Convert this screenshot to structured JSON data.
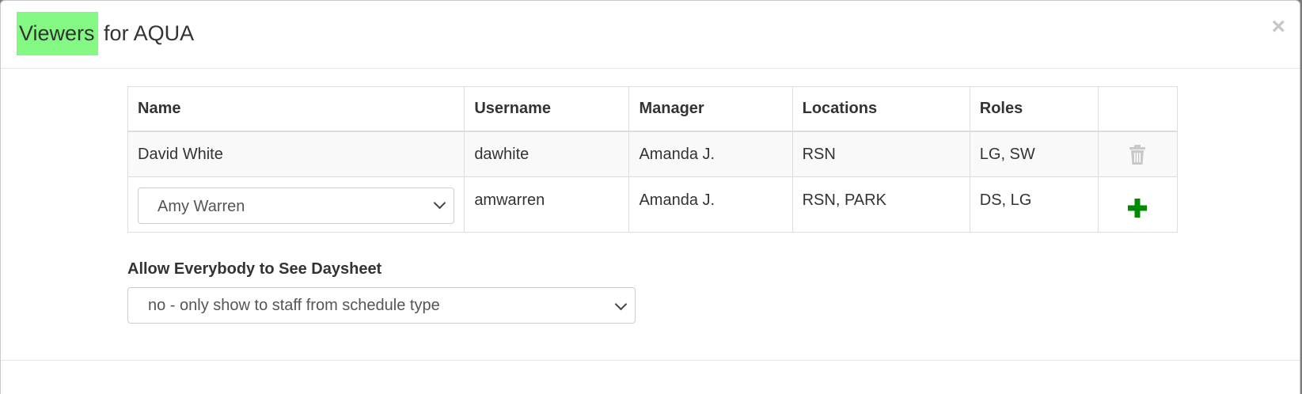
{
  "modal": {
    "title_highlight": "Viewers",
    "title_rest": " for AQUA",
    "close_label": "×"
  },
  "table": {
    "headers": [
      "Name",
      "Username",
      "Manager",
      "Locations",
      "Roles",
      ""
    ],
    "rows": [
      {
        "name": "David White",
        "username": "dawhite",
        "manager": "Amanda J.",
        "locations": "RSN",
        "roles": "LG, SW",
        "action_icon": "trash-icon"
      }
    ],
    "new_row": {
      "name_selected": "Amy Warren",
      "username": "amwarren",
      "manager": "Amanda J.",
      "locations": "RSN, PARK",
      "roles": "DS, LG",
      "action_icon": "plus-icon"
    }
  },
  "allow": {
    "label": "Allow Everybody to See Daysheet",
    "selected": "no - only show to staff from schedule type"
  },
  "colors": {
    "highlight": "#83f883",
    "plus": "#008a00",
    "trash": "#c8c8c8"
  }
}
